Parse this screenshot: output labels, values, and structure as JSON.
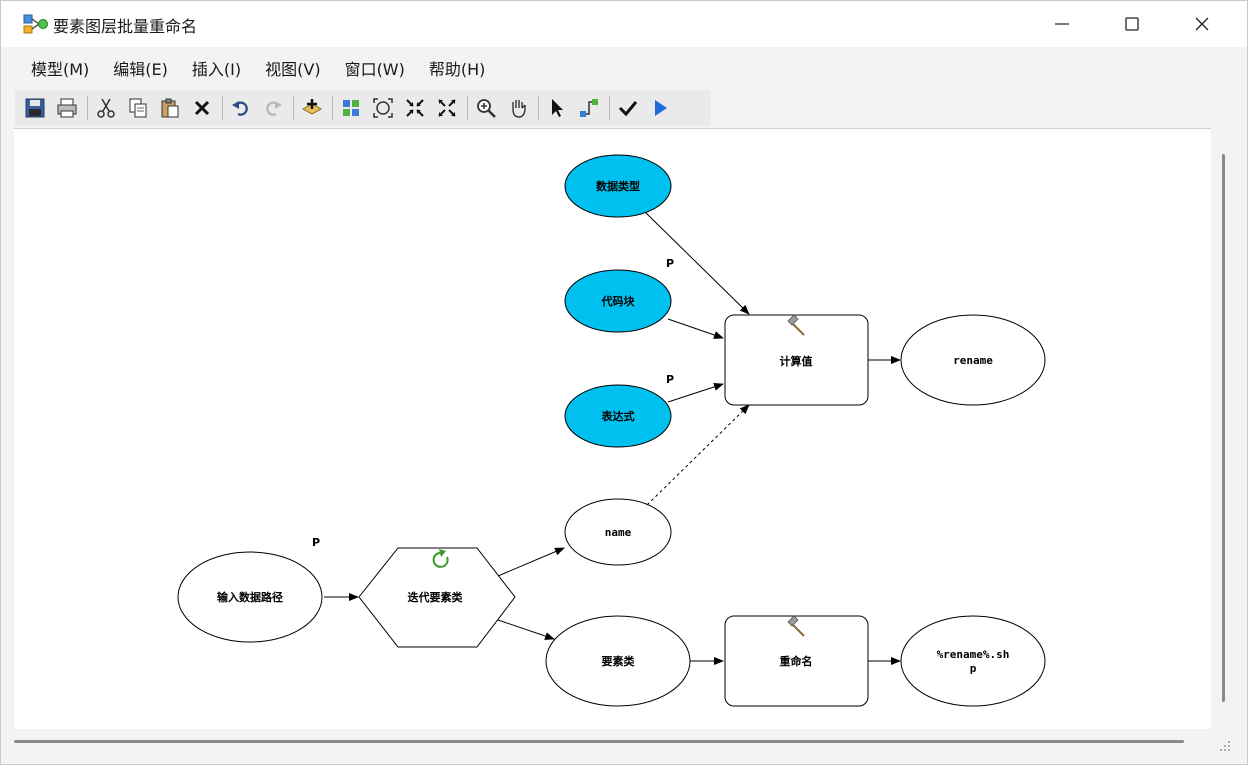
{
  "window": {
    "title": "要素图层批量重命名"
  },
  "menu": {
    "items": [
      {
        "label": "模型(M)"
      },
      {
        "label": "编辑(E)"
      },
      {
        "label": "插入(I)"
      },
      {
        "label": "视图(V)"
      },
      {
        "label": "窗口(W)"
      },
      {
        "label": "帮助(H)"
      }
    ]
  },
  "toolbar": {
    "buttons": [
      "save-icon",
      "print-icon",
      "cut-icon",
      "copy-icon",
      "paste-icon",
      "delete-icon",
      "undo-icon",
      "redo-icon",
      "add-data-icon",
      "auto-layout-icon",
      "full-extent-icon",
      "zoom-in-fixed-icon",
      "zoom-out-fixed-icon",
      "zoom-in-icon",
      "pan-icon",
      "select-icon",
      "connect-icon",
      "validate-icon",
      "run-icon"
    ]
  },
  "diagram": {
    "nodes": {
      "data_type": "数据类型",
      "code_block": "代码块",
      "expression": "表达式",
      "calc_value": "计算值",
      "rename_var": "rename",
      "name_var": "name",
      "input_path": "输入数据路径",
      "iterate": "迭代要素类",
      "feature_class": "要素类",
      "rename_tool": "重命名",
      "output_line1": "%rename%.sh",
      "output_line2": "p"
    },
    "param_marks": {
      "code_block_p": "P",
      "expression_p": "P",
      "input_path_p": "P"
    }
  },
  "colors": {
    "input_fill": "#00c0f0",
    "node_stroke": "#000000",
    "iterate_icon": "#3a9a2a"
  }
}
